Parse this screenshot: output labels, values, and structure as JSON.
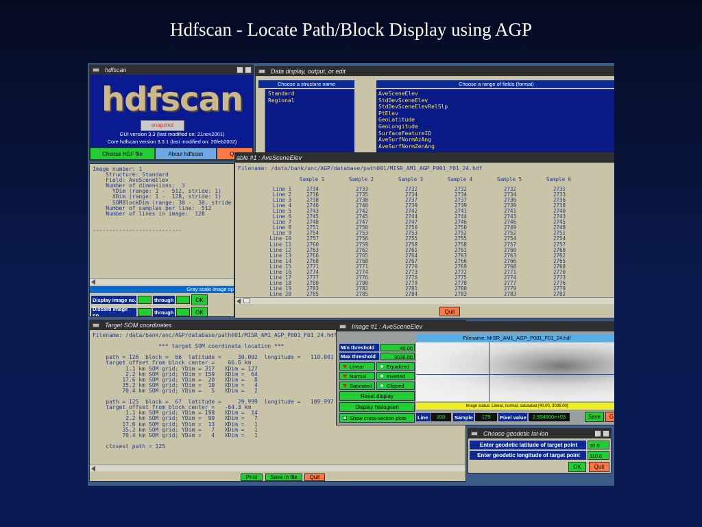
{
  "slide_title": "Hdfscan - Locate Path/Block Display using AGP",
  "hdfscan_win": {
    "title": "hdfscan",
    "logo_text": "hdfscan",
    "snapshot_label": "snapshot",
    "gui_version": "GUI version 3.3 (last modified on: 21nov2001)",
    "core_version": "Core hdfscan version 3.3.1 (last modified on: 20feb2002)",
    "choose_btn": "Choose HDF file",
    "about_btn": "About hdfscan",
    "quit_btn": "Quit"
  },
  "data_win": {
    "title": "Data display, output, or edit",
    "structure_header": "Choose a structure name",
    "fields_header": "Choose a range of  fields (format)",
    "structures": [
      "Standard",
      "Regional"
    ],
    "fields": [
      "AveSceneElev",
      "StdDevSceneElev",
      "StdDevSceneElevRelSlp",
      "PtElev",
      "GeoLatitude",
      "GeoLongitude",
      "SurfaceFeatureID",
      "AveSurfNormAzAng",
      "AveSurfNormZenAng"
    ]
  },
  "info_win": {
    "text": "Image number: 1\n    Structure: Standard\n    Field: AveSceneElev\n    Number of dimensions:  3\n      YDim (range: 1 -  512, stride: 1)\n      XDim (range: 1 -  128, stride: 1)\n      SOMBlockDim (range: 30 -  30, stride\n    Number of samples per line:  512\n    Number of lines in image:  128\n\n\n---------------------------",
    "gray_label": "Gray scale image op",
    "display_label": "Display image no.",
    "discard_label": "Discard image no.",
    "through": "through",
    "ok": "OK"
  },
  "table_win": {
    "title": "able #1 : AveSceneElev",
    "filename": "Filename: /data/bank/anc/AGP/database/path001/MISR_AM1_AGP_P001_F01_24.hdf",
    "columns": [
      "Sample 1",
      "Sample 2",
      "Sample 3",
      "Sample 4",
      "Sample 5",
      "Sample 6"
    ],
    "rows": [
      [
        "Line 1",
        "2734",
        "2733",
        "2732",
        "2732",
        "2732",
        "2731"
      ],
      [
        "Line 2",
        "2736",
        "2735",
        "2734",
        "2734",
        "2734",
        "2733"
      ],
      [
        "Line 3",
        "2738",
        "2738",
        "2737",
        "2737",
        "2736",
        "2736"
      ],
      [
        "Line 4",
        "2740",
        "2740",
        "2739",
        "2739",
        "2739",
        "2738"
      ],
      [
        "Line 5",
        "2743",
        "2742",
        "2742",
        "2741",
        "2741",
        "2740"
      ],
      [
        "Line 6",
        "2745",
        "2745",
        "2744",
        "2744",
        "2743",
        "2743"
      ],
      [
        "Line 7",
        "2748",
        "2747",
        "2747",
        "2746",
        "2746",
        "2745"
      ],
      [
        "Line 8",
        "2751",
        "2750",
        "2750",
        "2750",
        "2749",
        "2748"
      ],
      [
        "Line 9",
        "2754",
        "2753",
        "2753",
        "2752",
        "2752",
        "2751"
      ],
      [
        "Line 10",
        "2757",
        "2756",
        "2755",
        "2755",
        "2754",
        "2754"
      ],
      [
        "Line 11",
        "2760",
        "2759",
        "2758",
        "2758",
        "2757",
        "2757"
      ],
      [
        "Line 12",
        "2763",
        "2762",
        "2761",
        "2761",
        "2760",
        "2760"
      ],
      [
        "Line 13",
        "2766",
        "2765",
        "2764",
        "2763",
        "2763",
        "2762"
      ],
      [
        "Line 14",
        "2768",
        "2768",
        "2767",
        "2766",
        "2766",
        "2765"
      ],
      [
        "Line 15",
        "2771",
        "2771",
        "2770",
        "2769",
        "2768",
        "2768"
      ],
      [
        "Line 16",
        "2774",
        "2774",
        "2773",
        "2772",
        "2771",
        "2770"
      ],
      [
        "Line 17",
        "2777",
        "2776",
        "2776",
        "2775",
        "2774",
        "2773"
      ],
      [
        "Line 18",
        "2780",
        "2780",
        "2779",
        "2778",
        "2777",
        "2776"
      ],
      [
        "Line 19",
        "2783",
        "2782",
        "2781",
        "2780",
        "2779",
        "2779"
      ],
      [
        "Line 20",
        "2785",
        "2785",
        "2784",
        "2783",
        "2783",
        "2782"
      ]
    ],
    "quit": "Quit"
  },
  "som_win": {
    "title": "Target SOM coordinates",
    "text": "Filename: /data/bank/anc/AGP/database/path001/MISR_AM1_AGP_P001_F01_24.hdf\n\n                    *** target SOM coordinate location ***\n\n    path = 126  block =  66  latitude =     30.002  longitude =   110.001\n    target offset from block center =    66.6 km\n          1.1 km SOM grid; YDim = 317   XDim = 127\n          2.2 km SOM grid; YDim = 159   XDim =  64\n         17.6 km SOM grid; YDim =  20   XDim =   8\n         35.2 km SOM grid; YDim =  10   XDim =   4\n         70.4 km SOM grid; YDim =   5   XDim =   2\n\n    path = 125  block =  67  latitude =     29.999  longitude =   109.997\n    target offset from block center =   -64.3 km\n          1.1 km SOM grid; YDim = 198   XDim =  14\n          2.2 km SOM grid; YDim =  99   XDim =   7\n         17.6 km SOM grid; YDim =  13   XDim =   1\n         35.2 km SOM grid; YDim =   7   XDim =   1\n         70.4 km SOM grid; YDim =   4   XDim =   1\n\n    closest path = 125",
    "print": "Print",
    "save": "Save in file",
    "quit": "Quit"
  },
  "image_win": {
    "title": "Image #1 : AveSceneElev",
    "filename": "Filename: MISR_AM1_AGP_P001_F01_24.hdf",
    "min_label": "Min threshold",
    "min_value": "40.00",
    "max_label": "Max threshold",
    "max_value": "3036.00",
    "linear": "Linear",
    "equalized": "Equalized",
    "normal": "Normal",
    "inverted": "Inverted",
    "saturated": "Saturated",
    "clipped": "Clipped",
    "reset": "Reset display",
    "histogram": "Display histogram",
    "cross": "Show cross-section plots",
    "status": "Image status: Linear, normal, saturated [40.00, 3036.00]",
    "line_label": "Line",
    "line_value": "100",
    "sample_label": "Sample",
    "sample_value": "179",
    "pixel_label": "Pixel value",
    "pixel_value": "2.934000e+03",
    "save": "Save",
    "g": "G"
  },
  "geo_win": {
    "title": "Choose geodetic lat-lon",
    "lat_label": "Enter geodetic latitude of target point",
    "lat_value": "30.0",
    "lon_label": "Enter geodetic longitude of target point",
    "lon_value": "110.0",
    "ok": "OK",
    "quit": "Quit"
  }
}
